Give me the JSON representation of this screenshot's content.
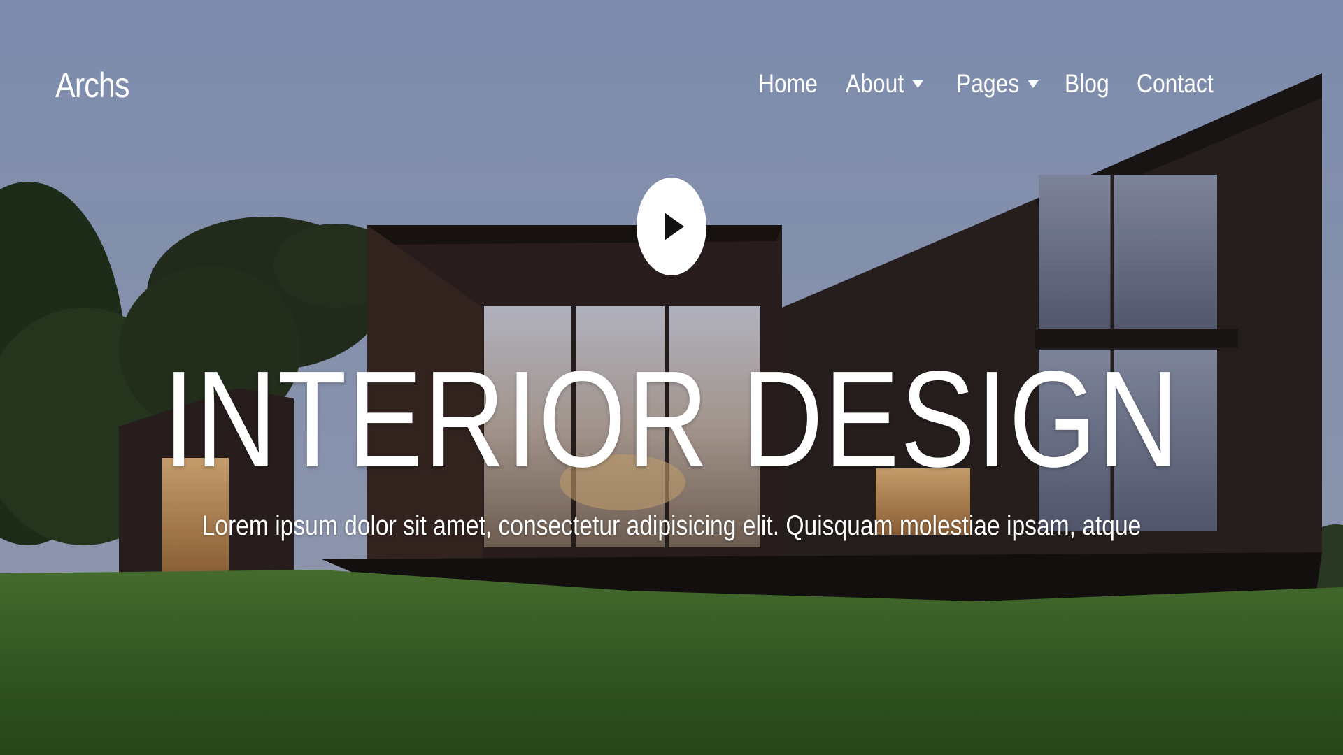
{
  "brand": {
    "name": "Archs"
  },
  "nav": {
    "items": [
      {
        "label": "Home",
        "has_dropdown": false
      },
      {
        "label": "About",
        "has_dropdown": true
      },
      {
        "label": "Pages",
        "has_dropdown": true
      },
      {
        "label": "Blog",
        "has_dropdown": false
      },
      {
        "label": "Contact",
        "has_dropdown": false
      }
    ]
  },
  "hero": {
    "title": "INTERIOR DESIGN",
    "subtitle": "Lorem ipsum dolor sit amet, consectetur adipisicing elit. Quisquam molestiae ipsam, atque",
    "play_icon": "play-icon"
  },
  "colors": {
    "text": "#ffffff",
    "sky": "#8e9fc2",
    "grass": "#3f6a2c",
    "building": "#2a2120"
  }
}
